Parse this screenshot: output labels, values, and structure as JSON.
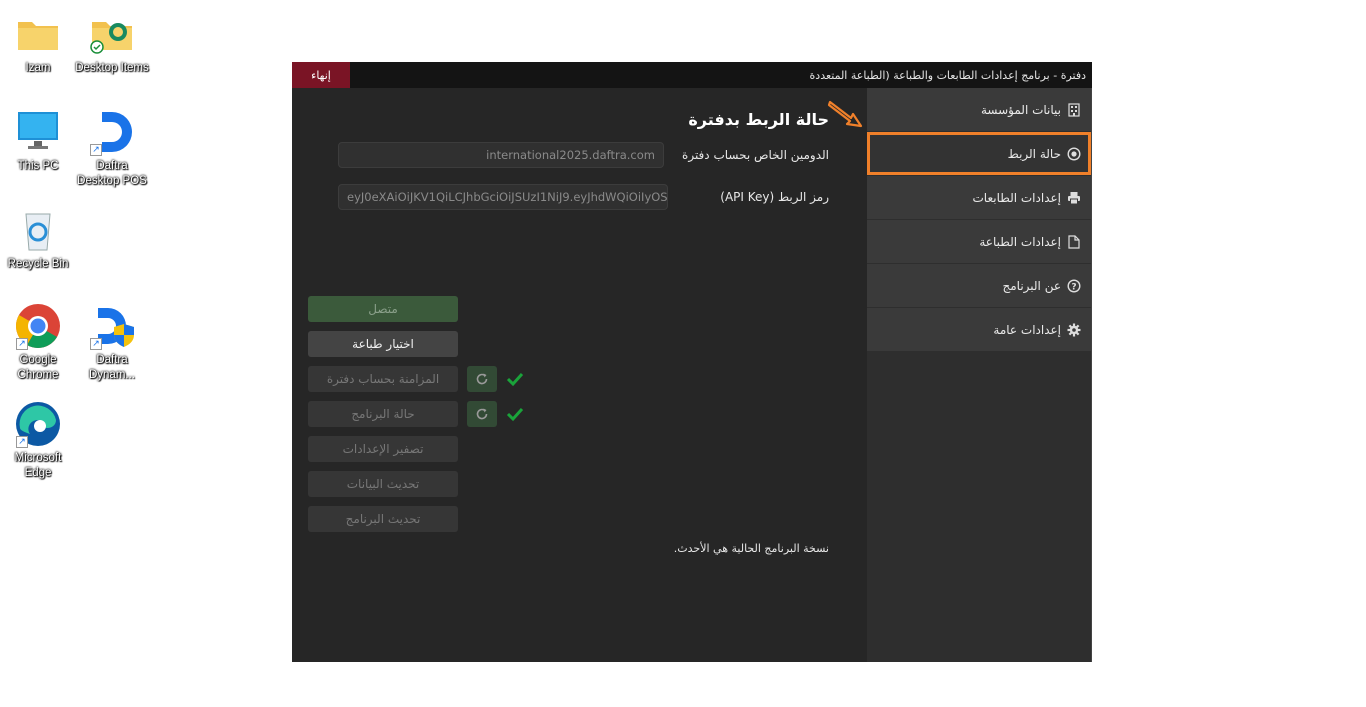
{
  "desktop": {
    "icons": [
      {
        "label": "Izam"
      },
      {
        "label": "Desktop Items"
      },
      {
        "label": "This PC"
      },
      {
        "label": "Daftra Desktop POS"
      },
      {
        "label": "Recycle Bin"
      },
      {
        "label": "Google Chrome"
      },
      {
        "label": "Daftra Dynam..."
      },
      {
        "label": "Microsoft Edge"
      }
    ]
  },
  "window": {
    "title": "دفترة - برنامج إعدادات الطابعات والطباعة (الطباعة المتعددة",
    "end_button": "إنهاء"
  },
  "sidebar": {
    "items": [
      {
        "label": "بيانات المؤسسة",
        "icon": "building-icon"
      },
      {
        "label": "حالة الربط",
        "icon": "radio-dot-icon",
        "active": true
      },
      {
        "label": "إعدادات الطابعات",
        "icon": "printer-icon"
      },
      {
        "label": "إعدادات الطباعة",
        "icon": "file-icon"
      },
      {
        "label": "عن البرنامج",
        "icon": "question-circle-icon"
      },
      {
        "label": "إعدادات عامة",
        "icon": "gear-icon"
      }
    ]
  },
  "main": {
    "title": "حالة الربط بدفترة",
    "domain_label": "الدومين الخاص بحساب دفترة",
    "domain_value": "international2025.daftra.com",
    "api_label": "رمز الربط (API Key)",
    "api_value": "eyJ0eXAiOiJKV1QiLCJhbGciOiJSUzI1NiJ9.eyJhdWQiOiIyOSIs",
    "buttons": {
      "connected": "متصل",
      "choose_printer": "اختيار طباعة",
      "sync_account": "المزامنة بحساب دفترة",
      "program_status": "حالة البرنامج",
      "reset_settings": "تصفير الإعدادات",
      "update_data": "تحديث البيانات",
      "update_program": "تحديث البرنامج"
    },
    "note": "نسخة البرنامج الحالية هي الأحدث."
  },
  "colors": {
    "accent_highlight": "#f0802a",
    "end_button": "#7a1425",
    "success_check": "#1aa33a"
  }
}
